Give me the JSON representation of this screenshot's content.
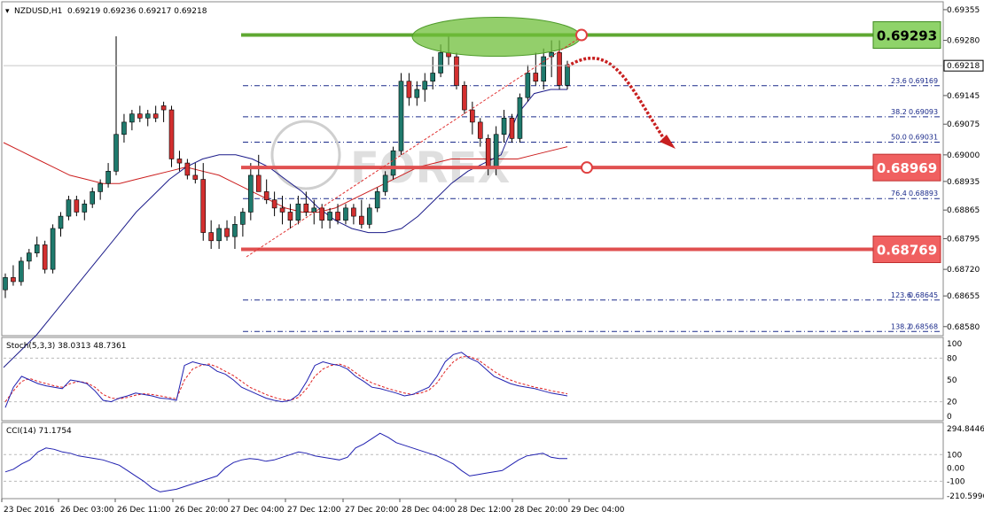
{
  "header": {
    "symbol": "NZDUSD,H1",
    "values": "0.69219 0.69236 0.69217 0.69218"
  },
  "colors": {
    "bull_candle": "#1f7a6d",
    "bear_candle": "#d32f2f",
    "ma_fast": "#1c1c8a",
    "ma_slow": "#cc1f1f",
    "resistance": "#5fa832",
    "support": "#e05050",
    "stoch_main": "#2020b0",
    "stoch_signal": "#e02020",
    "cci_line": "#2020b0"
  },
  "chart_data": [
    {
      "type": "candlestick",
      "pair": "NZDUSD",
      "timeframe": "H1",
      "ylim": [
        0.6856,
        0.6937
      ],
      "y_ticks": [
        "0.69355",
        "0.69280",
        "0.69218",
        "0.69145",
        "0.69075",
        "0.69000",
        "0.68935",
        "0.68865",
        "0.68795",
        "0.68720",
        "0.68655",
        "0.68580"
      ],
      "current_price": "0.69218",
      "x_tick_labels": [
        "23 Dec 2016",
        "26 Dec 03:00",
        "26 Dec 11:00",
        "26 Dec 20:00",
        "27 Dec 04:00",
        "27 Dec 12:00",
        "27 Dec 20:00",
        "28 Dec 04:00",
        "28 Dec 12:00",
        "28 Dec 20:00",
        "29 Dec 04:00"
      ],
      "levels": [
        {
          "name": "resistance",
          "value": 0.69293,
          "label": "0.69293"
        },
        {
          "name": "support-1",
          "value": 0.68969,
          "label": "0.68969"
        },
        {
          "name": "support-2",
          "value": 0.68769,
          "label": "0.68769"
        }
      ],
      "fibonacci": [
        {
          "ratio": "23.6",
          "value": "0.69169",
          "y": 0.69169
        },
        {
          "ratio": "38.2",
          "value": "0.69093",
          "y": 0.69093
        },
        {
          "ratio": "50.0",
          "value": "0.69031",
          "y": 0.69031
        },
        {
          "ratio": "76.4",
          "value": "0.68893",
          "y": 0.68893
        },
        {
          "ratio": "123.6",
          "value": "0.68645",
          "y": 0.68645
        },
        {
          "ratio": "138.2",
          "value": "0.68568",
          "y": 0.68568
        }
      ],
      "candles": [
        [
          0.6867,
          0.6871,
          0.6865,
          0.687
        ],
        [
          0.687,
          0.6873,
          0.6868,
          0.6869
        ],
        [
          0.6869,
          0.6875,
          0.6868,
          0.6874
        ],
        [
          0.6874,
          0.6877,
          0.6872,
          0.6876
        ],
        [
          0.6876,
          0.688,
          0.6875,
          0.6878
        ],
        [
          0.6878,
          0.6879,
          0.6871,
          0.6872
        ],
        [
          0.6872,
          0.6883,
          0.6871,
          0.6882
        ],
        [
          0.6882,
          0.6886,
          0.688,
          0.6885
        ],
        [
          0.6885,
          0.689,
          0.6884,
          0.6889
        ],
        [
          0.6889,
          0.689,
          0.6885,
          0.6886
        ],
        [
          0.6886,
          0.6889,
          0.6884,
          0.6888
        ],
        [
          0.6888,
          0.6892,
          0.6887,
          0.6891
        ],
        [
          0.6891,
          0.6894,
          0.6889,
          0.6893
        ],
        [
          0.6893,
          0.6898,
          0.6892,
          0.6896
        ],
        [
          0.6896,
          0.6929,
          0.6895,
          0.6905
        ],
        [
          0.6905,
          0.691,
          0.6903,
          0.6908
        ],
        [
          0.6908,
          0.6911,
          0.6906,
          0.691
        ],
        [
          0.691,
          0.6912,
          0.6908,
          0.6909
        ],
        [
          0.6909,
          0.6911,
          0.6907,
          0.691
        ],
        [
          0.691,
          0.6912,
          0.6908,
          0.6909
        ],
        [
          0.6912,
          0.6913,
          0.6908,
          0.6911
        ],
        [
          0.6911,
          0.6912,
          0.6897,
          0.6899
        ],
        [
          0.6899,
          0.6901,
          0.6896,
          0.6898
        ],
        [
          0.6898,
          0.6899,
          0.6894,
          0.6895
        ],
        [
          0.6895,
          0.6898,
          0.6893,
          0.6894
        ],
        [
          0.6894,
          0.6898,
          0.6879,
          0.6881
        ],
        [
          0.6881,
          0.6884,
          0.6877,
          0.6879
        ],
        [
          0.6879,
          0.6883,
          0.6877,
          0.6882
        ],
        [
          0.6882,
          0.6884,
          0.6879,
          0.688
        ],
        [
          0.688,
          0.6885,
          0.6877,
          0.6883
        ],
        [
          0.6883,
          0.6887,
          0.688,
          0.6886
        ],
        [
          0.6886,
          0.6898,
          0.6884,
          0.6895
        ],
        [
          0.6895,
          0.69,
          0.6892,
          0.6891
        ],
        [
          0.6891,
          0.6894,
          0.6888,
          0.6889
        ],
        [
          0.6889,
          0.6891,
          0.6885,
          0.6887
        ],
        [
          0.6887,
          0.689,
          0.6883,
          0.6886
        ],
        [
          0.6886,
          0.6888,
          0.6882,
          0.6884
        ],
        [
          0.6884,
          0.689,
          0.6883,
          0.6888
        ],
        [
          0.6888,
          0.6891,
          0.6885,
          0.6886
        ],
        [
          0.6886,
          0.6889,
          0.6883,
          0.6887
        ],
        [
          0.6887,
          0.6888,
          0.6882,
          0.6884
        ],
        [
          0.6884,
          0.6887,
          0.6882,
          0.6886
        ],
        [
          0.6886,
          0.6888,
          0.6883,
          0.6884
        ],
        [
          0.6884,
          0.6888,
          0.6883,
          0.6887
        ],
        [
          0.6887,
          0.6888,
          0.6883,
          0.6885
        ],
        [
          0.6885,
          0.6889,
          0.6882,
          0.6883
        ],
        [
          0.6883,
          0.6888,
          0.6882,
          0.6887
        ],
        [
          0.6887,
          0.6892,
          0.6886,
          0.6891
        ],
        [
          0.6891,
          0.6896,
          0.689,
          0.6895
        ],
        [
          0.6895,
          0.6902,
          0.6894,
          0.6901
        ],
        [
          0.6901,
          0.692,
          0.69,
          0.6918
        ],
        [
          0.6918,
          0.692,
          0.6912,
          0.6914
        ],
        [
          0.6914,
          0.6918,
          0.6912,
          0.6916
        ],
        [
          0.6916,
          0.692,
          0.6913,
          0.6918
        ],
        [
          0.6918,
          0.6924,
          0.6916,
          0.692
        ],
        [
          0.692,
          0.6927,
          0.6919,
          0.6925
        ],
        [
          0.6925,
          0.6929,
          0.6922,
          0.6924
        ],
        [
          0.6924,
          0.6925,
          0.6916,
          0.6917
        ],
        [
          0.6917,
          0.6918,
          0.691,
          0.6911
        ],
        [
          0.6911,
          0.6913,
          0.6905,
          0.6908
        ],
        [
          0.6908,
          0.6909,
          0.6902,
          0.6904
        ],
        [
          0.6904,
          0.6905,
          0.6895,
          0.6897
        ],
        [
          0.6897,
          0.6907,
          0.6895,
          0.6905
        ],
        [
          0.6905,
          0.6911,
          0.6903,
          0.6909
        ],
        [
          0.6909,
          0.691,
          0.6903,
          0.6904
        ],
        [
          0.6904,
          0.6915,
          0.6903,
          0.6914
        ],
        [
          0.6914,
          0.6922,
          0.6913,
          0.692
        ],
        [
          0.692,
          0.6925,
          0.6917,
          0.6918
        ],
        [
          0.6918,
          0.6926,
          0.6916,
          0.6924
        ],
        [
          0.6924,
          0.6928,
          0.6919,
          0.6925
        ],
        [
          0.6925,
          0.6928,
          0.6916,
          0.6917
        ],
        [
          0.6917,
          0.6923,
          0.6916,
          0.6922
        ]
      ],
      "ma_fast": [
        0.6848,
        0.6852,
        0.6856,
        0.6861,
        0.6866,
        0.6871,
        0.6876,
        0.6881,
        0.6886,
        0.689,
        0.6894,
        0.6897,
        0.6899,
        0.69,
        0.69,
        0.6899,
        0.6897,
        0.6894,
        0.6891,
        0.6887,
        0.6884,
        0.6882,
        0.6881,
        0.6881,
        0.6882,
        0.6885,
        0.6889,
        0.6893,
        0.6896,
        0.6898,
        0.69,
        0.691,
        0.6915,
        0.6916,
        0.6916
      ],
      "ma_slow": [
        0.6903,
        0.6901,
        0.6899,
        0.6897,
        0.6895,
        0.6894,
        0.6893,
        0.6893,
        0.6894,
        0.6895,
        0.6896,
        0.6897,
        0.6896,
        0.6895,
        0.6893,
        0.6891,
        0.6889,
        0.6887,
        0.6886,
        0.6886,
        0.6887,
        0.6889,
        0.6891,
        0.6893,
        0.6895,
        0.6897,
        0.6898,
        0.6899,
        0.6899,
        0.6899,
        0.6899,
        0.6899,
        0.69,
        0.6901,
        0.6902
      ]
    },
    {
      "type": "line",
      "title": "Stoch(5,3,3) 38.0313 48.7361",
      "ylim": [
        0,
        100
      ],
      "y_ticks": [
        "100",
        "80",
        "50",
        "20",
        "0"
      ],
      "series": [
        {
          "values": [
            12,
            40,
            55,
            50,
            45,
            42,
            40,
            38,
            50,
            48,
            45,
            35,
            22,
            20,
            25,
            28,
            32,
            30,
            28,
            25,
            24,
            22,
            70,
            75,
            72,
            70,
            62,
            58,
            50,
            40,
            35,
            30,
            25,
            22,
            20,
            22,
            30,
            48,
            70,
            75,
            72,
            70,
            65,
            55,
            48,
            40,
            38,
            35,
            32,
            28,
            30,
            35,
            40,
            55,
            75,
            85,
            88,
            80,
            75,
            65,
            55,
            50,
            45,
            42,
            40,
            38,
            35,
            32,
            30,
            28
          ]
        },
        {
          "values": [
            20,
            35,
            48,
            52,
            48,
            45,
            42,
            40,
            45,
            48,
            46,
            40,
            30,
            25,
            24,
            26,
            29,
            31,
            30,
            28,
            26,
            24,
            50,
            65,
            70,
            72,
            68,
            62,
            56,
            48,
            40,
            35,
            30,
            26,
            23,
            22,
            26,
            38,
            55,
            65,
            70,
            72,
            68,
            60,
            52,
            46,
            42,
            38,
            35,
            32,
            30,
            32,
            36,
            46,
            62,
            75,
            82,
            82,
            78,
            70,
            62,
            55,
            50,
            46,
            43,
            40,
            38,
            35,
            33,
            31
          ]
        }
      ]
    },
    {
      "type": "line",
      "title": "CCI(14) 71.1754",
      "ylim": [
        -210.5996,
        294.8446
      ],
      "y_ticks": [
        "294.8446",
        "100",
        "0.00",
        "-100",
        "-210.5996"
      ],
      "series": [
        {
          "values": [
            -30,
            -10,
            30,
            60,
            120,
            150,
            140,
            120,
            110,
            90,
            80,
            70,
            60,
            40,
            20,
            -20,
            -60,
            -100,
            -150,
            -180,
            -170,
            -160,
            -140,
            -120,
            -100,
            -80,
            -60,
            0,
            40,
            60,
            70,
            65,
            50,
            60,
            80,
            100,
            120,
            110,
            90,
            80,
            70,
            60,
            80,
            150,
            180,
            220,
            260,
            230,
            190,
            170,
            150,
            130,
            110,
            90,
            60,
            30,
            -20,
            -60,
            -50,
            -40,
            -30,
            -20,
            20,
            60,
            90,
            100,
            110,
            80,
            70,
            71
          ]
        }
      ]
    }
  ]
}
